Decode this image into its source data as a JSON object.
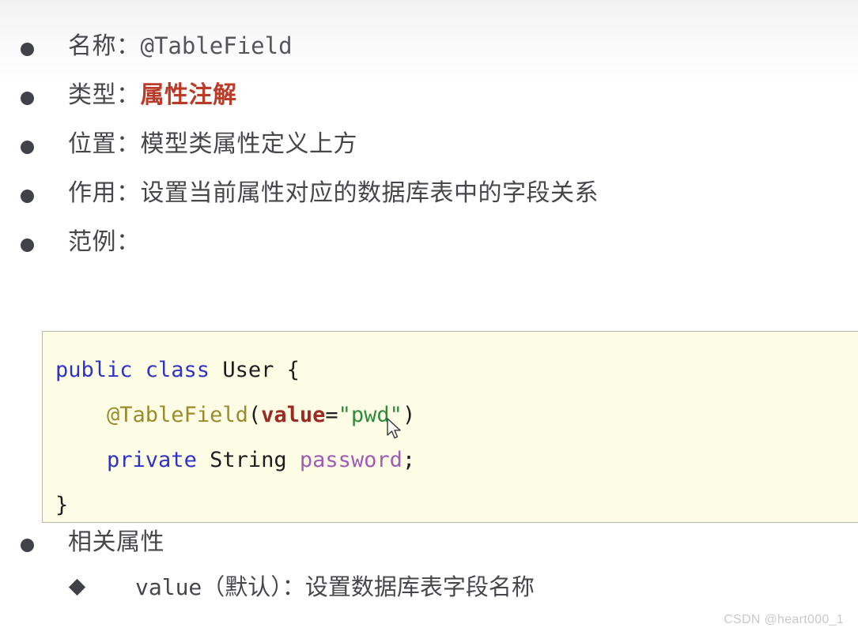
{
  "slide": {
    "bullets": [
      {
        "label": "名称：",
        "value": "@TableField",
        "value_style": "mono"
      },
      {
        "label": "类型：",
        "value": "属性注解",
        "value_style": "accent-red"
      },
      {
        "label": "位置：",
        "value": "模型类属性定义上方",
        "value_style": "plain"
      },
      {
        "label": "作用：",
        "value": "设置当前属性对应的数据库表中的字段关系",
        "value_style": "plain"
      },
      {
        "label": "范例：",
        "value": "",
        "value_style": "plain"
      }
    ],
    "code_block": {
      "language": "java",
      "background": "#fdfde6",
      "border_color": "#b8b8ad",
      "lines": [
        [
          {
            "t": "public class ",
            "c": "tok-kw"
          },
          {
            "t": "User",
            "c": "tok-type"
          },
          {
            "t": " {",
            "c": "tok-punc"
          }
        ],
        [
          {
            "t": "    ",
            "c": "tok-punc"
          },
          {
            "t": "@TableField",
            "c": "tok-anno"
          },
          {
            "t": "(",
            "c": "tok-punc"
          },
          {
            "t": "value",
            "c": "tok-attr"
          },
          {
            "t": "=",
            "c": "tok-punc"
          },
          {
            "t": "\"pwd\"",
            "c": "tok-str"
          },
          {
            "t": ")",
            "c": "tok-punc"
          }
        ],
        [
          {
            "t": "    ",
            "c": "tok-punc"
          },
          {
            "t": "private",
            "c": "tok-kw"
          },
          {
            "t": " String ",
            "c": "tok-type"
          },
          {
            "t": "password",
            "c": "tok-field"
          },
          {
            "t": ";",
            "c": "tok-punc"
          }
        ],
        [
          {
            "t": "}",
            "c": "tok-punc"
          }
        ]
      ],
      "plain_text": "public class User {\n    @TableField(value=\"pwd\")\n    private String password;\n}"
    },
    "related_heading": "相关属性",
    "related_items": [
      {
        "name": "value",
        "qualifier": "（默认）：",
        "description": "设置数据库表字段名称"
      }
    ]
  },
  "watermark": "CSDN @heart000_1",
  "colors": {
    "accent_red": "#bb3b29",
    "text": "#46464b",
    "code_bg": "#fdfde6",
    "code_border": "#b8b8ad",
    "keyword_blue": "#2f32c8",
    "annotation_olive": "#9a8b2c",
    "attribute_maroon": "#9c2a24",
    "string_green": "#2f8a3f",
    "field_purple": "#a05bb5",
    "watermark_gray": "#c9c9cc"
  }
}
